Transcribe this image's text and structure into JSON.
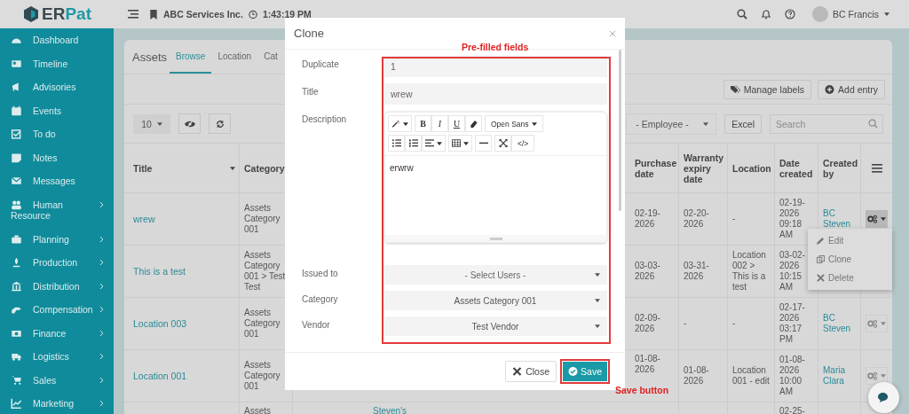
{
  "topbar": {
    "logo_dark": "ER",
    "logo_accent": "Pat",
    "company": "ABC Services Inc.",
    "time": "1:43:19 PM",
    "user": "BC Francis"
  },
  "sidebar": {
    "items": [
      {
        "label": "Dashboard",
        "expandable": false
      },
      {
        "label": "Timeline",
        "expandable": false
      },
      {
        "label": "Advisories",
        "expandable": false
      },
      {
        "label": "Events",
        "expandable": false
      },
      {
        "label": "To do",
        "expandable": false
      },
      {
        "label": "Notes",
        "expandable": false
      },
      {
        "label": "Messages",
        "expandable": false
      },
      {
        "label": "Human Resource",
        "expandable": true
      },
      {
        "label": "Planning",
        "expandable": true
      },
      {
        "label": "Production",
        "expandable": true
      },
      {
        "label": "Distribution",
        "expandable": true
      },
      {
        "label": "Compensation",
        "expandable": true
      },
      {
        "label": "Finance",
        "expandable": true
      },
      {
        "label": "Logistics",
        "expandable": true
      },
      {
        "label": "Sales",
        "expandable": true
      },
      {
        "label": "Marketing",
        "expandable": true
      }
    ]
  },
  "page": {
    "title": "Assets",
    "tabs": [
      {
        "label": "Browse",
        "selected": true
      },
      {
        "label": "Location",
        "selected": false
      },
      {
        "label": "Cat",
        "selected": false
      }
    ]
  },
  "actions": [
    "Manage labels",
    "Add entry"
  ],
  "filters": {
    "page_size": "10",
    "employee": "- Employee -",
    "export": "Excel",
    "search_placeholder": "Search"
  },
  "table": {
    "columns": [
      "Title",
      "Category",
      "Purchase date",
      "Warranty expiry date",
      "Location",
      "Date created",
      "Created by"
    ],
    "rows": [
      {
        "title": "wrew",
        "category": "Assets Category 001",
        "purchase_date": "02-19-2026",
        "warranty_expiry_date": "02-20-2026",
        "location": "-",
        "date_created": "02-19-2026 09:18 AM",
        "created_by": "BC Steven",
        "menu_open": true
      },
      {
        "title": "This is a test",
        "category": "Assets Category 001 > Test Test",
        "purchase_date": "03-03-2026",
        "warranty_expiry_date": "03-31-2026",
        "location": "Location 002 > This is a test",
        "date_created": "03-02-2026 10:15 AM",
        "created_by": ""
      },
      {
        "title": "Location 003",
        "category": "Assets Category 001",
        "purchase_date": "02-09-2026",
        "warranty_expiry_date": "-",
        "location": "-",
        "date_created": "02-17-2026 03:17 PM",
        "created_by": "BC Steven",
        "menu_open": false
      },
      {
        "title": "Location 001",
        "category": "Assets Category 001",
        "purchase_date": "01-08-2026",
        "warranty_expiry_date": "01-08-2026",
        "location": "Location 001 - edit",
        "date_created": "01-08-2026 10:00 AM",
        "created_by": "Maria Clara",
        "menu_open": false
      },
      {
        "title": "",
        "category": "Assets",
        "column_3": "Steven's",
        "purchase_date": "",
        "warranty_expiry_date": "",
        "location": "",
        "date_created": "02-25-",
        "created_by": ""
      }
    ]
  },
  "row_menu": {
    "items": [
      "Edit",
      "Clone",
      "Delete"
    ]
  },
  "modal": {
    "title": "Clone",
    "fields": [
      {
        "label": "Duplicate",
        "kind": "input",
        "value": "1"
      },
      {
        "label": "Title",
        "kind": "input",
        "value": "wrew"
      },
      {
        "label": "Description",
        "kind": "editor",
        "value": "erwrw"
      },
      {
        "label": "Issued to",
        "kind": "select",
        "placeholder": "- Select Users -"
      },
      {
        "label": "Category",
        "kind": "select",
        "value": "Assets Category 001"
      },
      {
        "label": "Vendor",
        "kind": "select",
        "value": "Test Vendor"
      }
    ],
    "editor_toolbar": {
      "bold": "B",
      "italic": "I",
      "underline": "U",
      "font": "Open Sans",
      "code": "</>"
    },
    "buttons": [
      "Close",
      "Save"
    ]
  },
  "annotations": [
    {
      "text": "Pre-filled fields"
    },
    {
      "text": "Save button"
    }
  ]
}
